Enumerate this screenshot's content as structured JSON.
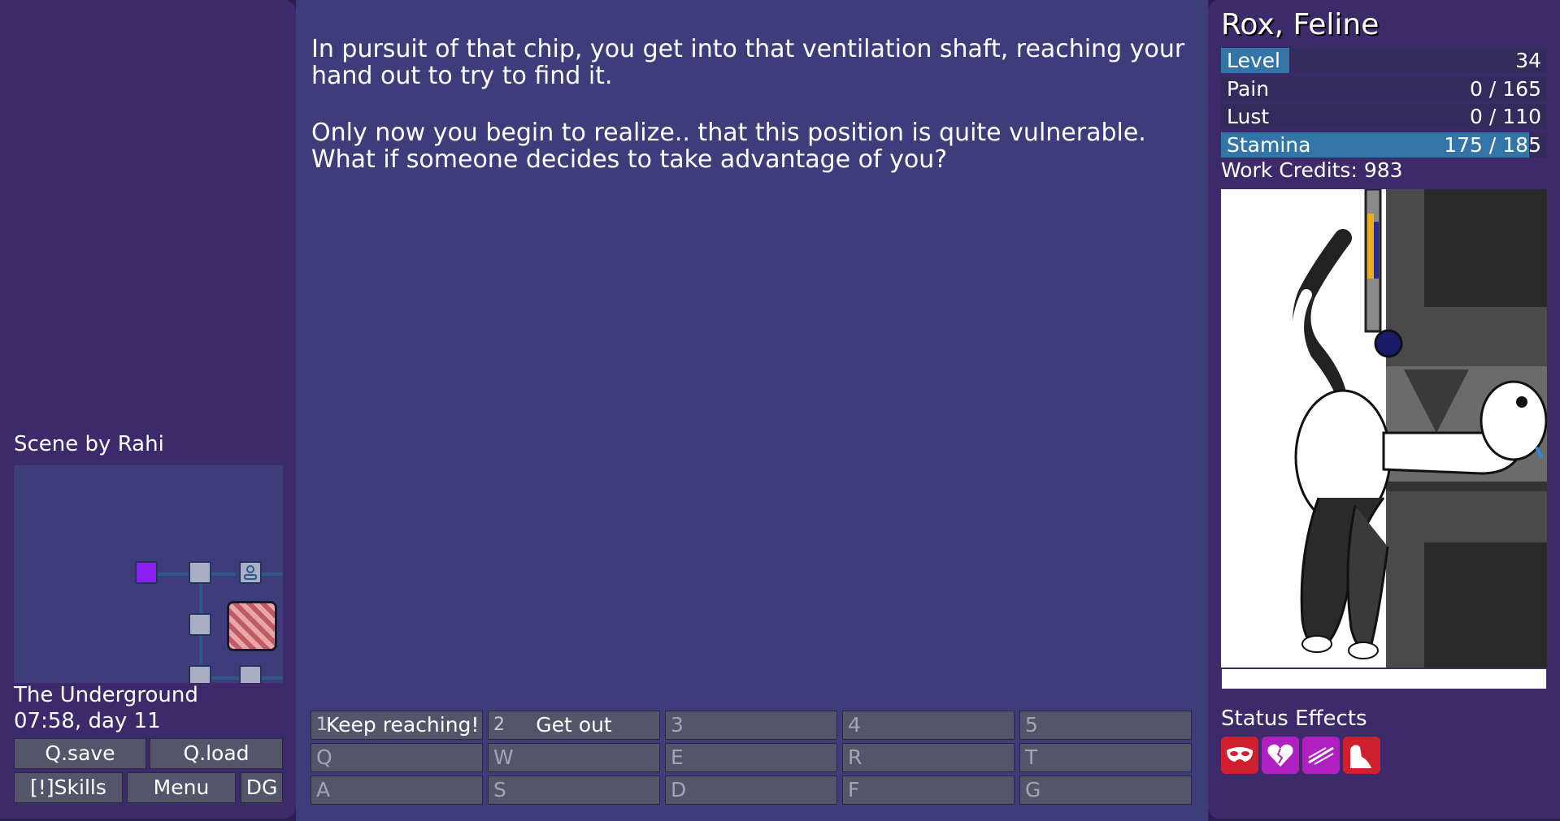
{
  "story": {
    "paragraphs": [
      "In pursuit of that chip, you get into that ventilation shaft, reaching your hand out to try to find it.",
      "Only now you begin to realize.. that this position is quite vulnerable. What if someone decides to take advantage of you?"
    ]
  },
  "left_panel": {
    "scene_credit": "Scene by Rahi",
    "location": "The Underground",
    "time": "07:58, day 11",
    "buttons": {
      "qsave": "Q.save",
      "qload": "Q.load",
      "skills": "[!]Skills",
      "menu": "Menu",
      "dg": "DG"
    }
  },
  "choices": [
    {
      "key": "1",
      "label": "Keep reaching!"
    },
    {
      "key": "2",
      "label": "Get out"
    },
    {
      "key": "3",
      "label": ""
    },
    {
      "key": "4",
      "label": ""
    },
    {
      "key": "5",
      "label": ""
    },
    {
      "key": "Q",
      "label": ""
    },
    {
      "key": "W",
      "label": ""
    },
    {
      "key": "E",
      "label": ""
    },
    {
      "key": "R",
      "label": ""
    },
    {
      "key": "T",
      "label": ""
    },
    {
      "key": "A",
      "label": ""
    },
    {
      "key": "S",
      "label": ""
    },
    {
      "key": "D",
      "label": ""
    },
    {
      "key": "F",
      "label": ""
    },
    {
      "key": "G",
      "label": ""
    }
  ],
  "character": {
    "name": "Rox, Feline",
    "stats": {
      "level": {
        "label": "Level",
        "value": "34",
        "fraction": 0.21
      },
      "pain": {
        "label": "Pain",
        "value": "0 / 165",
        "fraction": 0
      },
      "lust": {
        "label": "Lust",
        "value": "0 / 110",
        "fraction": 0
      },
      "stamina": {
        "label": "Stamina",
        "value": "175 / 185",
        "fraction": 0.946
      }
    },
    "work_credits": "Work Credits: 983"
  },
  "status_effects": {
    "title": "Status Effects",
    "icons": [
      "mask-icon",
      "broken-heart-icon",
      "slash-icon",
      "paw-icon"
    ]
  },
  "colors": {
    "bar_fill": "#3475a8",
    "current_room": "#8a1ff0",
    "status_red": "#d02030",
    "status_purple": "#b020c0"
  }
}
